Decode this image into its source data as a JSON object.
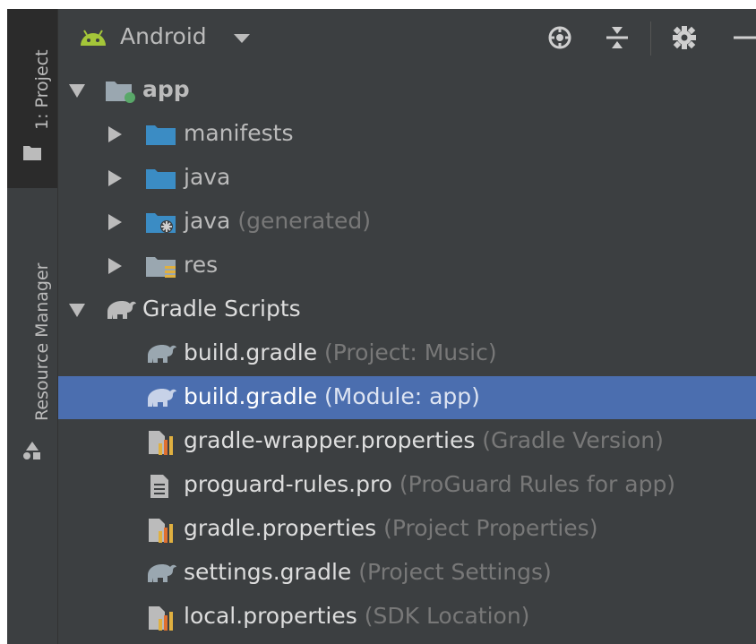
{
  "sidebar": {
    "tabs": [
      {
        "label": "1: Project",
        "icon": "folder-icon",
        "active": true
      },
      {
        "label": "Resource Manager",
        "icon": "resource-manager-icon",
        "active": false
      }
    ]
  },
  "toolbar": {
    "view_label": "Android",
    "view_icon": "android-icon",
    "buttons": [
      "locate-icon",
      "collapse-all-icon",
      "gear-icon",
      "minimize-icon"
    ]
  },
  "tree": {
    "app": {
      "label": "app",
      "icon": "module-folder-icon"
    },
    "manifests": {
      "label": "manifests",
      "icon": "folder-icon"
    },
    "java": {
      "label": "java",
      "icon": "folder-icon"
    },
    "java_generated": {
      "label": "java",
      "hint": " (generated)",
      "icon": "generated-folder-icon"
    },
    "res": {
      "label": "res",
      "icon": "res-folder-icon"
    },
    "gradle_scripts": {
      "label": "Gradle Scripts",
      "icon": "gradle-icon"
    },
    "build_gradle_project": {
      "label": "build.gradle",
      "hint": " (Project: Music)",
      "icon": "gradle-icon"
    },
    "build_gradle_module": {
      "label": "build.gradle",
      "hint": " (Module: app)",
      "icon": "gradle-icon"
    },
    "gradle_wrapper": {
      "label": "gradle-wrapper.properties",
      "hint": " (Gradle Version)",
      "icon": "properties-icon"
    },
    "proguard": {
      "label": "proguard-rules.pro",
      "hint": " (ProGuard Rules for app)",
      "icon": "text-file-icon"
    },
    "gradle_properties": {
      "label": "gradle.properties",
      "hint": " (Project Properties)",
      "icon": "properties-icon"
    },
    "settings_gradle": {
      "label": "settings.gradle",
      "hint": " (Project Settings)",
      "icon": "gradle-icon"
    },
    "local_properties": {
      "label": "local.properties",
      "hint": " (SDK Location)",
      "icon": "properties-icon"
    }
  },
  "colors": {
    "panel": "#3c3f41",
    "selection": "#4b6eaf",
    "folder_blue": "#3b8cc4",
    "android_green": "#a4c639",
    "hint": "#787878"
  }
}
